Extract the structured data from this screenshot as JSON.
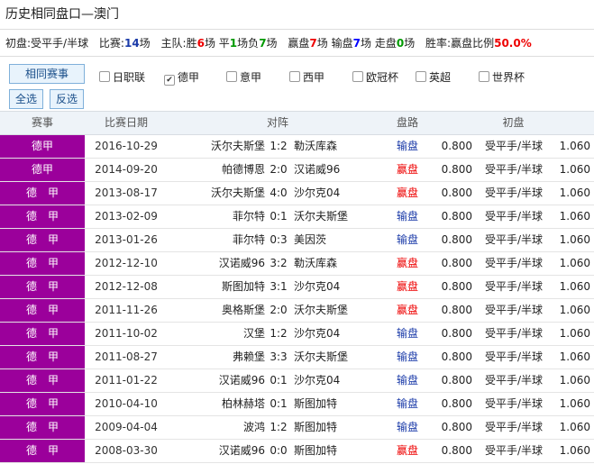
{
  "page_title": "历史相同盘口—澳门",
  "summary": {
    "label_initial": "初盘:",
    "initial_value": "受平手/半球",
    "label_matches": "比赛:",
    "matches_count": "14",
    "matches_unit": "场",
    "label_home": "主队:",
    "win_label": "胜",
    "win_count": "6",
    "win_unit": "场",
    "draw_label": "平",
    "draw_count": "1",
    "draw_unit": "场",
    "lose_label": "负",
    "lose_count": "7",
    "lose_unit": "场",
    "ying_label": "赢盘",
    "ying_count": "7",
    "ying_unit": "场",
    "shu_label": "输盘",
    "shu_count": "7",
    "shu_unit": "场",
    "zou_label": "走盘",
    "zou_count": "0",
    "zou_unit": "场",
    "rate_label": "胜率:",
    "rate_prefix": "赢盘比例",
    "rate_value": "50.0%"
  },
  "buttons": {
    "same_league": "相同赛事",
    "select_all": "全选",
    "invert": "反选"
  },
  "leagues": [
    {
      "label": "日职联",
      "checked": false
    },
    {
      "label": "德甲",
      "checked": true
    },
    {
      "label": "意甲",
      "checked": false
    },
    {
      "label": "西甲",
      "checked": false
    },
    {
      "label": "欧冠杯",
      "checked": false
    },
    {
      "label": "英超",
      "checked": false
    },
    {
      "label": "世界杯",
      "checked": false
    }
  ],
  "headers": {
    "league": "赛事",
    "date": "比赛日期",
    "match": "对阵",
    "result": "盘路",
    "initial": "初盘"
  },
  "rows": [
    {
      "league": "德甲",
      "date": "2016-10-29",
      "home": "沃尔夫斯堡",
      "score": "1:2",
      "away": "勒沃库森",
      "result": "输盘",
      "type": "lose",
      "o1": "0.800",
      "hcp": "受平手/半球",
      "o2": "1.060"
    },
    {
      "league": "德甲",
      "date": "2014-09-20",
      "home": "帕德博恩",
      "score": "2:0",
      "away": "汉诺威96",
      "result": "赢盘",
      "type": "win",
      "o1": "0.800",
      "hcp": "受平手/半球",
      "o2": "1.060"
    },
    {
      "league": "德　甲",
      "date": "2013-08-17",
      "home": "沃尔夫斯堡",
      "score": "4:0",
      "away": "沙尔克04",
      "result": "赢盘",
      "type": "win",
      "o1": "0.800",
      "hcp": "受平手/半球",
      "o2": "1.060"
    },
    {
      "league": "德　甲",
      "date": "2013-02-09",
      "home": "菲尔特",
      "score": "0:1",
      "away": "沃尔夫斯堡",
      "result": "输盘",
      "type": "lose",
      "o1": "0.800",
      "hcp": "受平手/半球",
      "o2": "1.060"
    },
    {
      "league": "德　甲",
      "date": "2013-01-26",
      "home": "菲尔特",
      "score": "0:3",
      "away": "美因茨",
      "result": "输盘",
      "type": "lose",
      "o1": "0.800",
      "hcp": "受平手/半球",
      "o2": "1.060"
    },
    {
      "league": "德　甲",
      "date": "2012-12-10",
      "home": "汉诺威96",
      "score": "3:2",
      "away": "勒沃库森",
      "result": "赢盘",
      "type": "win",
      "o1": "0.800",
      "hcp": "受平手/半球",
      "o2": "1.060"
    },
    {
      "league": "德　甲",
      "date": "2012-12-08",
      "home": "斯图加特",
      "score": "3:1",
      "away": "沙尔克04",
      "result": "赢盘",
      "type": "win",
      "o1": "0.800",
      "hcp": "受平手/半球",
      "o2": "1.060"
    },
    {
      "league": "德　甲",
      "date": "2011-11-26",
      "home": "奥格斯堡",
      "score": "2:0",
      "away": "沃尔夫斯堡",
      "result": "赢盘",
      "type": "win",
      "o1": "0.800",
      "hcp": "受平手/半球",
      "o2": "1.060"
    },
    {
      "league": "德　甲",
      "date": "2011-10-02",
      "home": "汉堡",
      "score": "1:2",
      "away": "沙尔克04",
      "result": "输盘",
      "type": "lose",
      "o1": "0.800",
      "hcp": "受平手/半球",
      "o2": "1.060"
    },
    {
      "league": "德　甲",
      "date": "2011-08-27",
      "home": "弗赖堡",
      "score": "3:3",
      "away": "沃尔夫斯堡",
      "result": "输盘",
      "type": "lose",
      "o1": "0.800",
      "hcp": "受平手/半球",
      "o2": "1.060"
    },
    {
      "league": "德　甲",
      "date": "2011-01-22",
      "home": "汉诺威96",
      "score": "0:1",
      "away": "沙尔克04",
      "result": "输盘",
      "type": "lose",
      "o1": "0.800",
      "hcp": "受平手/半球",
      "o2": "1.060"
    },
    {
      "league": "德　甲",
      "date": "2010-04-10",
      "home": "柏林赫塔",
      "score": "0:1",
      "away": "斯图加特",
      "result": "输盘",
      "type": "lose",
      "o1": "0.800",
      "hcp": "受平手/半球",
      "o2": "1.060"
    },
    {
      "league": "德　甲",
      "date": "2009-04-04",
      "home": "波鸿",
      "score": "1:2",
      "away": "斯图加特",
      "result": "输盘",
      "type": "lose",
      "o1": "0.800",
      "hcp": "受平手/半球",
      "o2": "1.060"
    },
    {
      "league": "德　甲",
      "date": "2008-03-30",
      "home": "汉诺威96",
      "score": "0:0",
      "away": "斯图加特",
      "result": "赢盘",
      "type": "win",
      "o1": "0.800",
      "hcp": "受平手/半球",
      "o2": "1.060"
    }
  ],
  "colors": {
    "league_bg": "#9b009b",
    "win": "#e00000",
    "lose": "#1a3aa8"
  }
}
